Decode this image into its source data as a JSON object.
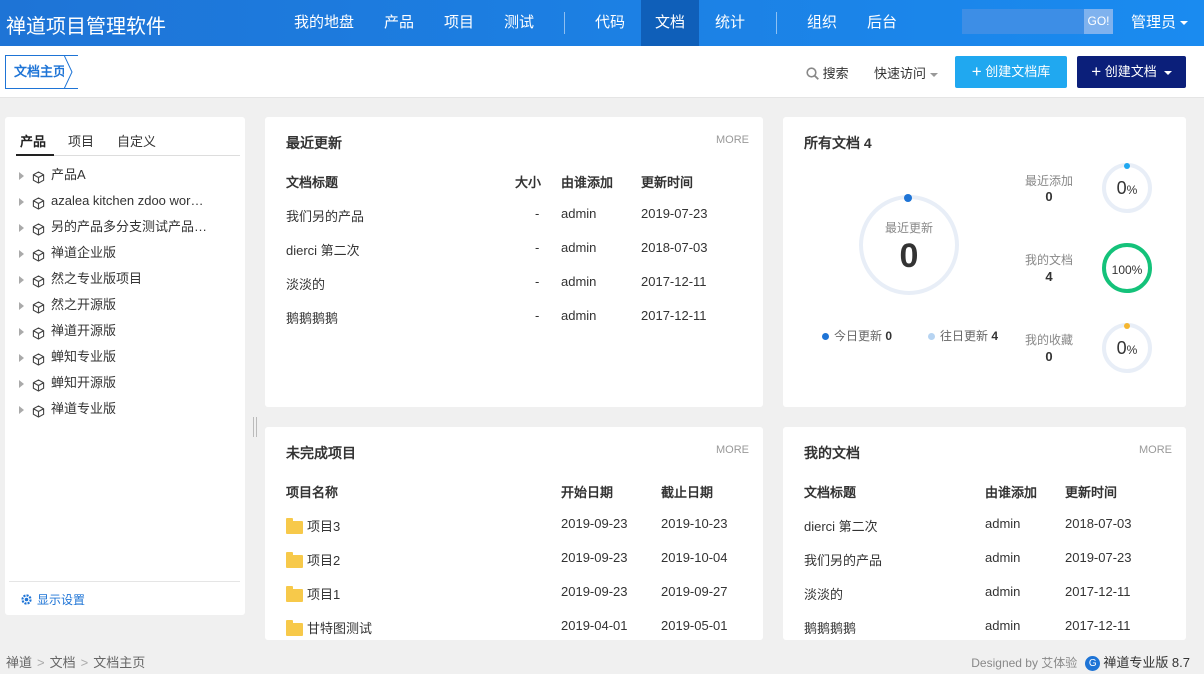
{
  "app": {
    "title": "禅道项目管理软件"
  },
  "nav": {
    "items": [
      {
        "label": "我的地盘"
      },
      {
        "label": "产品"
      },
      {
        "label": "项目"
      },
      {
        "label": "测试"
      },
      {
        "label": "代码"
      },
      {
        "label": "文档",
        "active": true
      },
      {
        "label": "统计"
      },
      {
        "label": "组织"
      },
      {
        "label": "后台"
      }
    ],
    "search_placeholder": "",
    "go_label": "GO!",
    "user_label": "管理员"
  },
  "subbar": {
    "home_label": "文档主页",
    "search_label": "搜索",
    "quick_label": "快速访问",
    "create_lib_label": "创建文档库",
    "create_doc_label": "创建文档"
  },
  "sidebar": {
    "tabs": [
      {
        "label": "产品"
      },
      {
        "label": "项目"
      },
      {
        "label": "自定义"
      }
    ],
    "items": [
      {
        "label": "产品A"
      },
      {
        "label": "azalea kitchen zdoo wor…"
      },
      {
        "label": "另的产品多分支测试产品…"
      },
      {
        "label": "禅道企业版"
      },
      {
        "label": "然之专业版项目"
      },
      {
        "label": "然之开源版"
      },
      {
        "label": "禅道开源版"
      },
      {
        "label": "蝉知专业版"
      },
      {
        "label": "蝉知开源版"
      },
      {
        "label": "禅道专业版"
      }
    ],
    "settings_label": "显示设置"
  },
  "recent": {
    "title": "最近更新",
    "more": "MORE",
    "headers": {
      "title": "文档标题",
      "size": "大小",
      "added_by": "由谁添加",
      "updated": "更新时间"
    },
    "rows": [
      {
        "title": "我们另的产品",
        "size": "-",
        "added_by": "admin",
        "updated": "2019-07-23"
      },
      {
        "title": "dierci 第二次",
        "size": "-",
        "added_by": "admin",
        "updated": "2018-07-03"
      },
      {
        "title": "淡淡的",
        "size": "-",
        "added_by": "admin",
        "updated": "2017-12-11"
      },
      {
        "title": "鹅鹅鹅鹅",
        "size": "-",
        "added_by": "admin",
        "updated": "2017-12-11"
      }
    ]
  },
  "all_docs": {
    "title": "所有文档 4",
    "center_label": "最近更新",
    "center_value": "0",
    "legend_today_label": "今日更新",
    "legend_today_value": "0",
    "legend_past_label": "往日更新",
    "legend_past_value": "4",
    "colors": {
      "primary": "#1e74d6",
      "past": "#b7d4f2",
      "success": "#14c27a",
      "info": "#20a8f0",
      "warning": "#f5b630"
    },
    "stats": [
      {
        "label": "最近添加",
        "value": "0",
        "ring": "0",
        "unit": "%"
      },
      {
        "label": "我的文档",
        "value": "4",
        "ring": "100",
        "unit": "%"
      },
      {
        "label": "我的收藏",
        "value": "0",
        "ring": "0",
        "unit": "%"
      }
    ]
  },
  "projects": {
    "title": "未完成项目",
    "more": "MORE",
    "headers": {
      "name": "项目名称",
      "start": "开始日期",
      "end": "截止日期"
    },
    "rows": [
      {
        "name": "项目3",
        "start": "2019-09-23",
        "end": "2019-10-23"
      },
      {
        "name": "项目2",
        "start": "2019-09-23",
        "end": "2019-10-04"
      },
      {
        "name": "项目1",
        "start": "2019-09-23",
        "end": "2019-09-27"
      },
      {
        "name": "甘特图测试",
        "start": "2019-04-01",
        "end": "2019-05-01"
      }
    ]
  },
  "my_docs": {
    "title": "我的文档",
    "more": "MORE",
    "headers": {
      "title": "文档标题",
      "added_by": "由谁添加",
      "updated": "更新时间"
    },
    "rows": [
      {
        "title": "dierci 第二次",
        "added_by": "admin",
        "updated": "2018-07-03"
      },
      {
        "title": "我们另的产品",
        "added_by": "admin",
        "updated": "2019-07-23"
      },
      {
        "title": "淡淡的",
        "added_by": "admin",
        "updated": "2017-12-11"
      },
      {
        "title": "鹅鹅鹅鹅",
        "added_by": "admin",
        "updated": "2017-12-11"
      }
    ]
  },
  "footer": {
    "crumbs": [
      {
        "label": "禅道"
      },
      {
        "label": "文档"
      },
      {
        "label": "文档主页"
      }
    ],
    "designed_by": "Designed by 艾体验",
    "version": "禅道专业版 8.7"
  }
}
